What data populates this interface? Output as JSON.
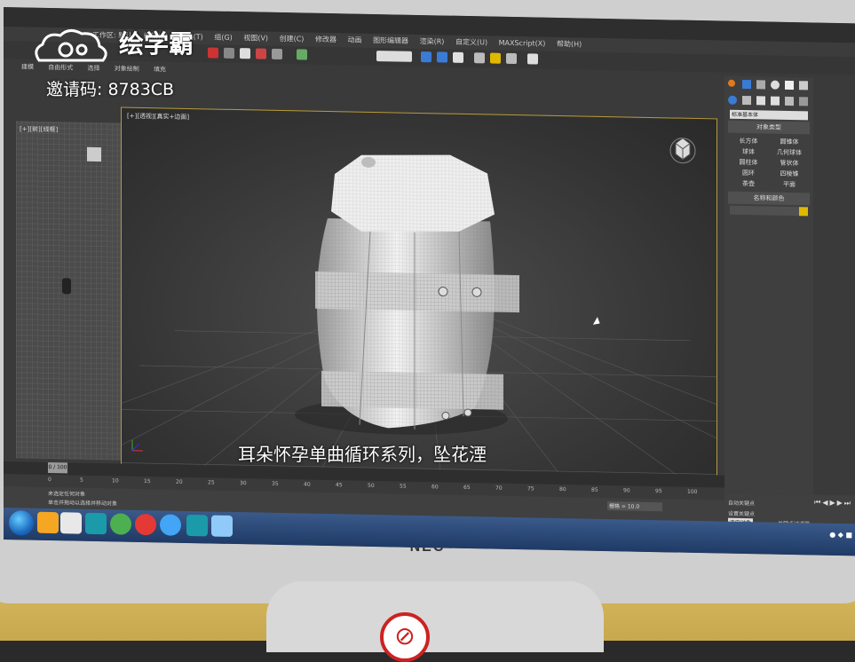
{
  "watermark": {
    "brand": "绘学霸",
    "invite_code": "邀请码: 8783CB"
  },
  "subtitle": "耳朵怀孕单曲循环系列，坠花湮",
  "monitor": {
    "brand": "NEC"
  },
  "app": {
    "menu_items": [
      "工作区: 默认",
      "编辑(E)",
      "工具(T)",
      "组(G)",
      "视图(V)",
      "创建(C)",
      "修改器",
      "动画",
      "图形编辑器",
      "渲染(R)",
      "自定义(U)",
      "MAXScript(X)",
      "帮助(H)"
    ],
    "command_tabs": [
      "建模",
      "自由形式",
      "选择",
      "对象绘制",
      "填充"
    ],
    "left_viewport_label": "[+][前][线框]",
    "viewport_label": "[+][透视][真实+边面]",
    "right_panel": {
      "dropdown": "标准基本体",
      "object_type_header": "对象类型",
      "object_types": [
        "长方体",
        "圆锥体",
        "球体",
        "几何球体",
        "圆柱体",
        "管状体",
        "圆环",
        "四棱锥",
        "茶壶",
        "平面"
      ],
      "name_color_header": "名称和颜色"
    },
    "timeline": {
      "slider": "0 / 100"
    },
    "ruler_ticks": [
      "0",
      "5",
      "10",
      "15",
      "20",
      "25",
      "30",
      "35",
      "40",
      "45",
      "50",
      "55",
      "60",
      "65",
      "70",
      "75",
      "80",
      "85",
      "90",
      "95",
      "100"
    ],
    "status": {
      "line1": "未选定任何对象",
      "line2": "单击并拖动以选择并移动对象",
      "frame_field": "栅格 = 10.0",
      "auto_key": "自动关键点",
      "set_key": "设置关键点",
      "selection_set": "选定对象",
      "key_filters": "关键点过滤器"
    }
  },
  "colors": {
    "viewport_border": "#b89a3a",
    "taskbar": "#1f3a66",
    "accent_yellow": "#e0b800"
  }
}
